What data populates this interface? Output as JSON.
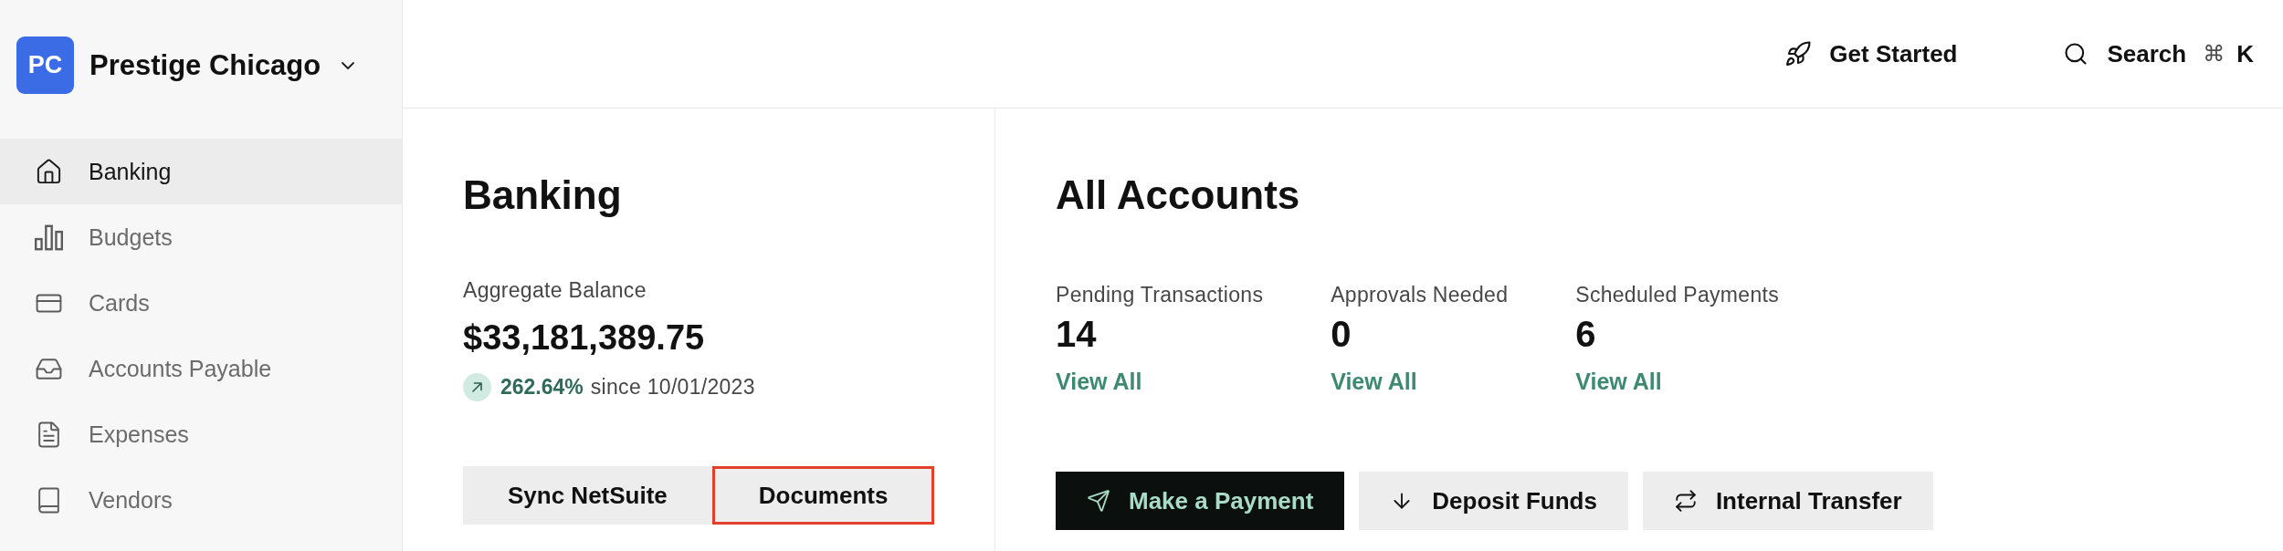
{
  "sidebar": {
    "org": {
      "initials": "PC",
      "name": "Prestige Chicago"
    },
    "items": [
      {
        "label": "Banking",
        "selected": true
      },
      {
        "label": "Budgets",
        "selected": false
      },
      {
        "label": "Cards",
        "selected": false
      },
      {
        "label": "Accounts Payable",
        "selected": false
      },
      {
        "label": "Expenses",
        "selected": false
      },
      {
        "label": "Vendors",
        "selected": false
      }
    ]
  },
  "header": {
    "get_started": {
      "label": "Get Started"
    },
    "search": {
      "label": "Search",
      "shortcut": [
        "⌘",
        "K"
      ]
    }
  },
  "banking": {
    "title": "Banking",
    "balance_label": "Aggregate Balance",
    "balance": "$33,181,389.75",
    "change": {
      "percent": "262.64%",
      "since": "since 10/01/2023"
    },
    "buttons": [
      {
        "label": "Sync NetSuite",
        "outlined": false
      },
      {
        "label": "Documents",
        "outlined": true
      }
    ]
  },
  "all_accounts": {
    "title": "All Accounts",
    "stats": [
      {
        "label": "Pending Transactions",
        "value": "14",
        "link": "View All"
      },
      {
        "label": "Approvals Needed",
        "value": "0",
        "link": "View All"
      },
      {
        "label": "Scheduled Payments",
        "value": "6",
        "link": "View All"
      }
    ],
    "actions": [
      {
        "label": "Make a Payment",
        "kind": "primary"
      },
      {
        "label": "Deposit Funds",
        "kind": "secondary"
      },
      {
        "label": "Internal Transfer",
        "kind": "secondary"
      }
    ]
  }
}
